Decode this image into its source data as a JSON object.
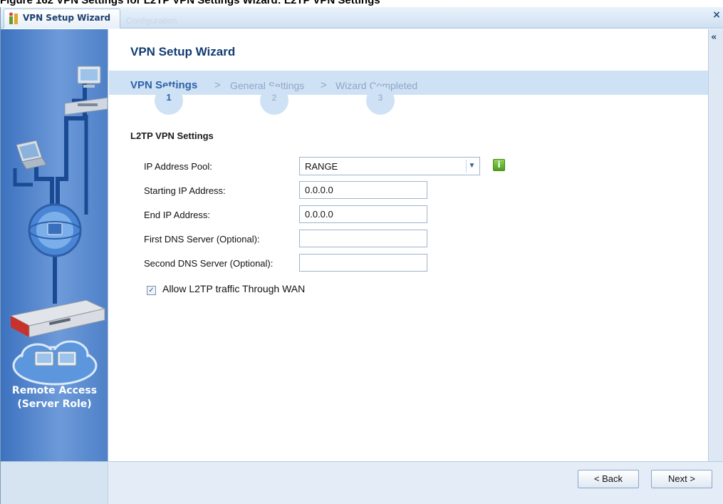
{
  "figure_caption": "Figure 162   VPN Settings for L2TP VPN Settings Wizard: L2TP VPN Settings",
  "window": {
    "title": "VPN Setup Wizard",
    "background_tab": "Configuration",
    "close_glyph": "×",
    "collapse_glyph": "«"
  },
  "sidebar": {
    "caption_line1": "Remote Access",
    "caption_line2": "(Server Role)"
  },
  "wizard": {
    "title": "VPN Setup Wizard",
    "separator": ">",
    "steps": [
      {
        "label": "VPN Settings",
        "number": "1",
        "active": true
      },
      {
        "label": "General Settings",
        "number": "2",
        "active": false
      },
      {
        "label": "Wizard Completed",
        "number": "3",
        "active": false
      }
    ]
  },
  "form": {
    "section_title": "L2TP VPN Settings",
    "ip_pool": {
      "label": "IP Address Pool:",
      "value": "RANGE"
    },
    "start_ip": {
      "label": "Starting IP Address:",
      "value": "0.0.0.0"
    },
    "end_ip": {
      "label": "End IP Address:",
      "value": "0.0.0.0"
    },
    "dns1": {
      "label": "First DNS Server (Optional):",
      "value": ""
    },
    "dns2": {
      "label": "Second DNS Server (Optional):",
      "value": ""
    },
    "allow_wan": {
      "label": "Allow L2TP traffic Through WAN",
      "checked": true,
      "check_glyph": "✓"
    },
    "info_glyph": "i"
  },
  "footer": {
    "back_label": "< Back",
    "next_label": "Next >"
  },
  "colors": {
    "accent": "#2b63a8",
    "title": "#123c73",
    "step_bar": "#cfe1f5",
    "sidebar": "#4f81c8",
    "info_green": "#5aa82a"
  }
}
